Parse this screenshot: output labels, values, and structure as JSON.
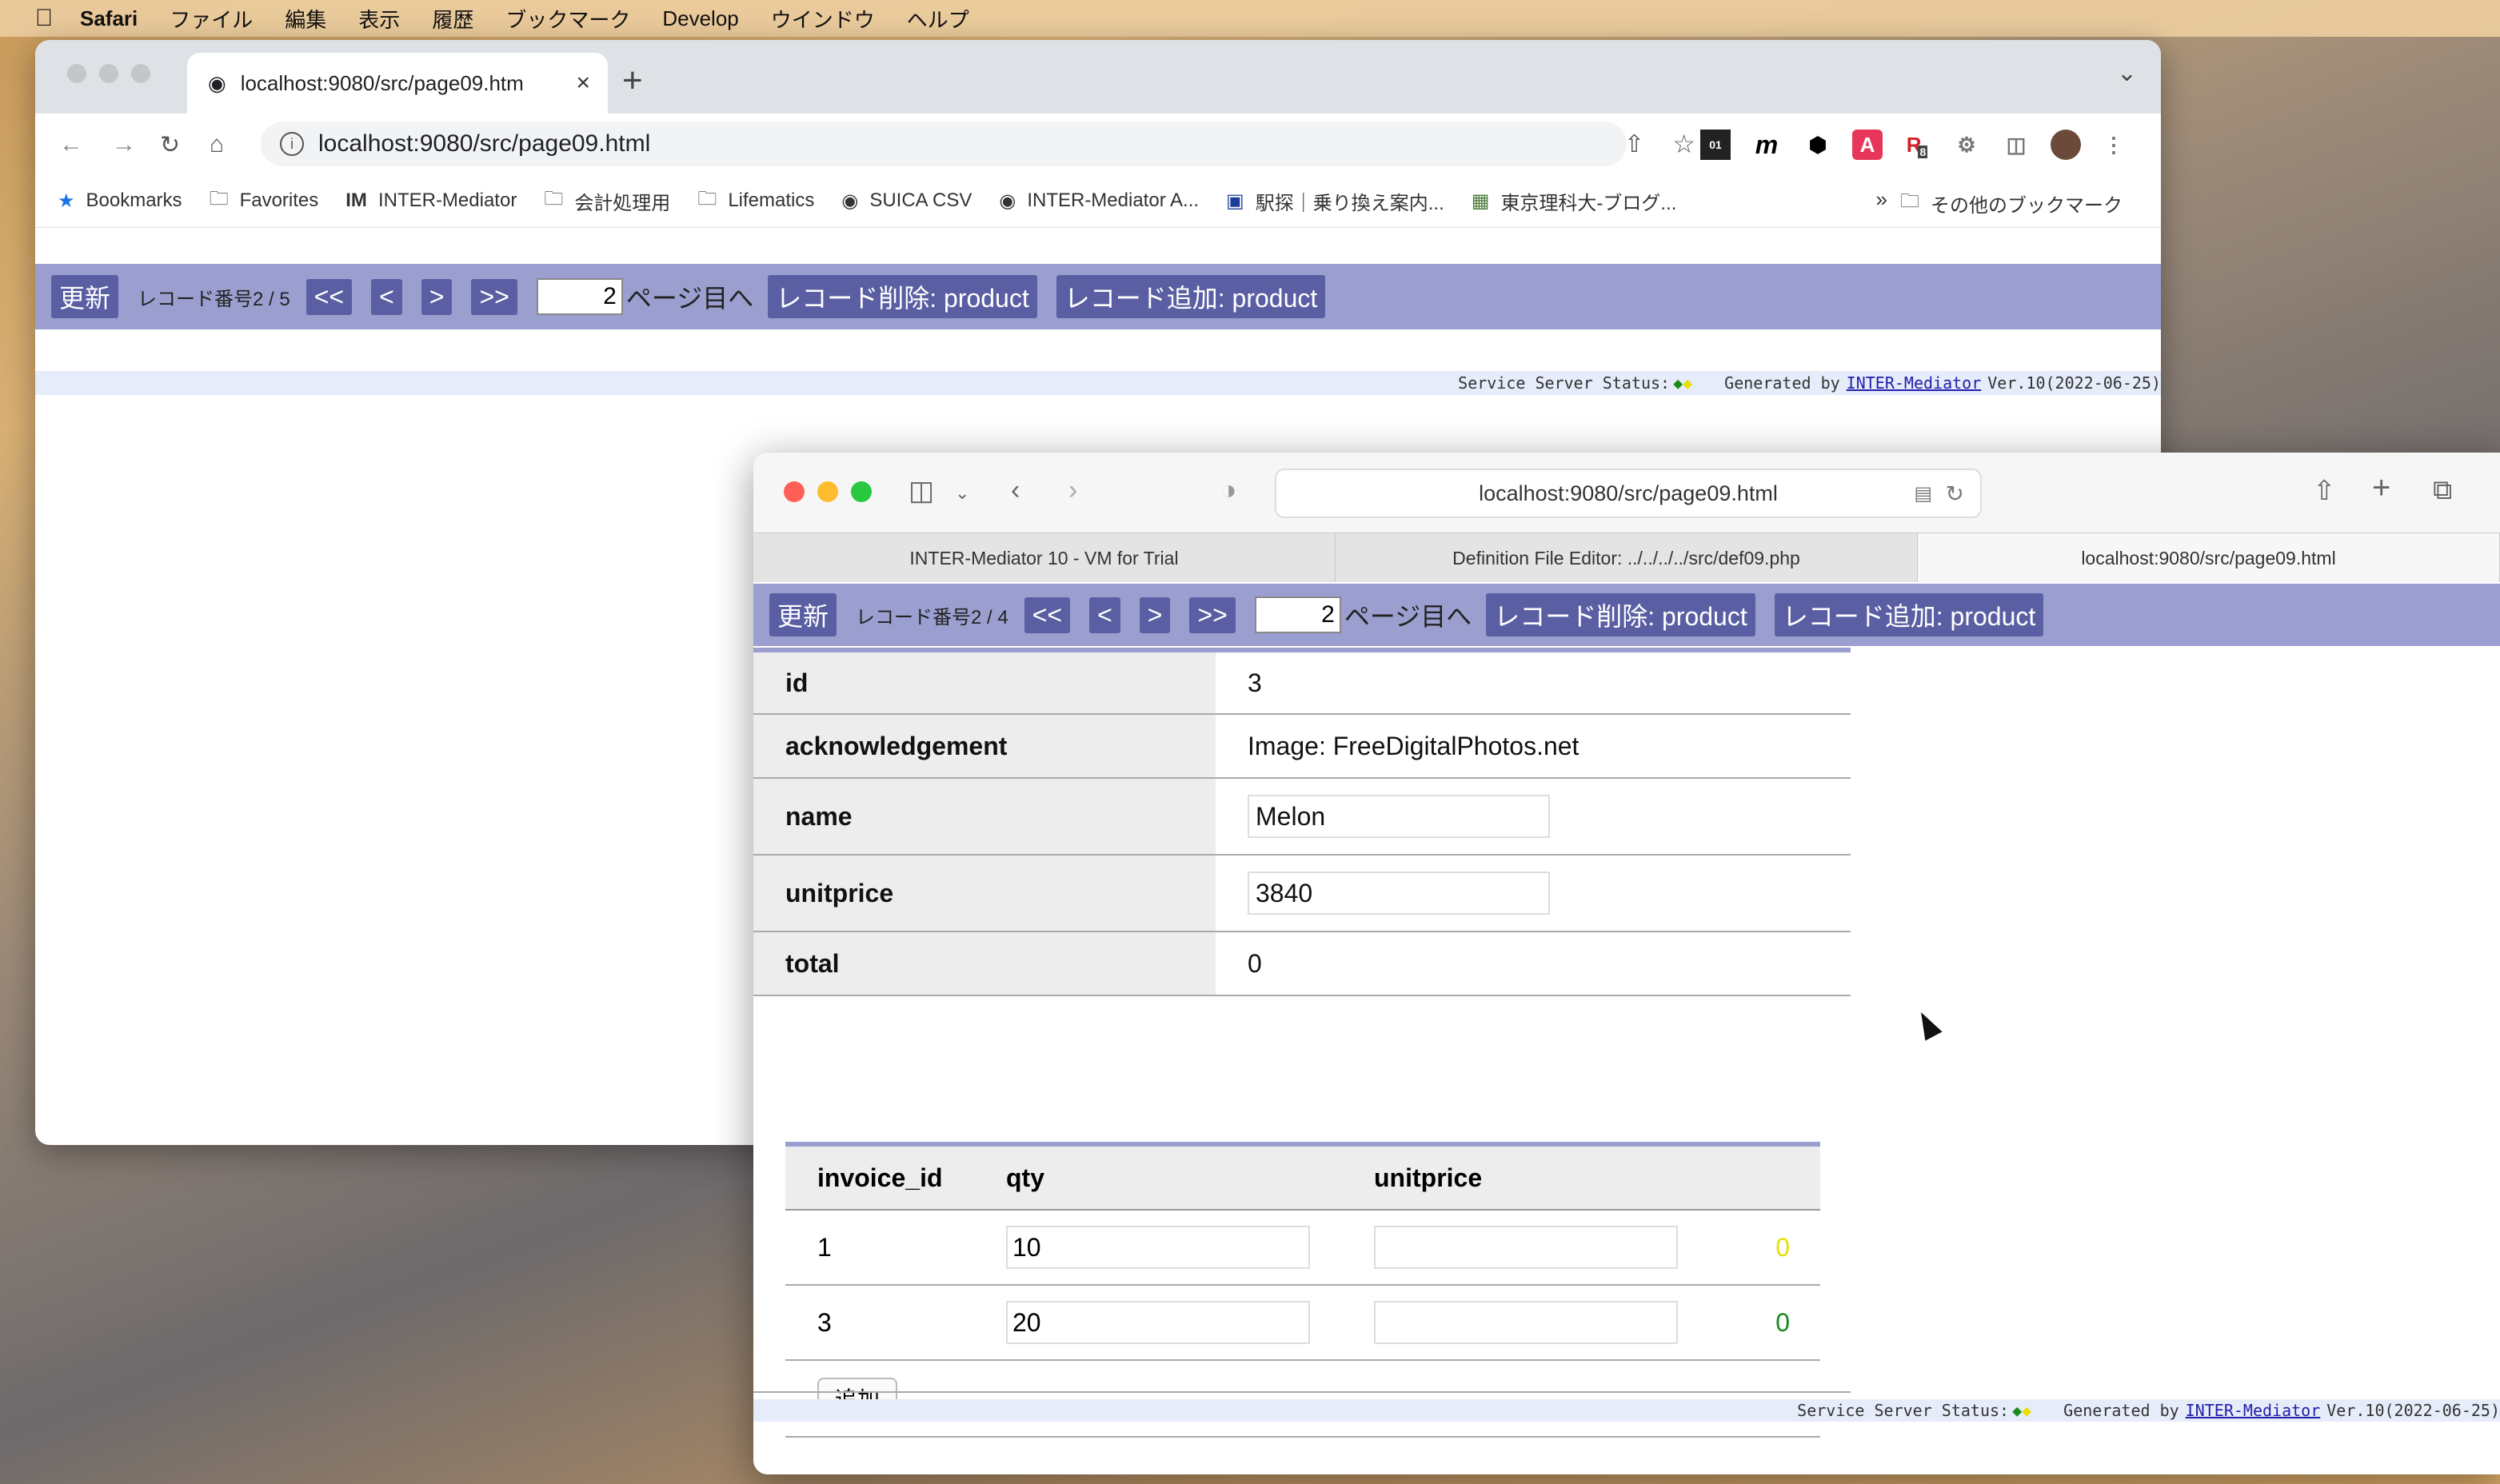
{
  "menubar": {
    "app": "Safari",
    "items": [
      "ファイル",
      "編集",
      "表示",
      "履歴",
      "ブックマーク",
      "Develop",
      "ウインドウ",
      "ヘルプ"
    ]
  },
  "chrome": {
    "tab_title": "localhost:9080/src/page09.htm",
    "url": "localhost:9080/src/page09.html",
    "ext_badge": "8",
    "bookmarks": [
      {
        "icon": "star-icon",
        "label": "Bookmarks"
      },
      {
        "icon": "folder-icon",
        "label": "Favorites"
      },
      {
        "icon": "im-logo-icon",
        "label": "INTER-Mediator"
      },
      {
        "icon": "folder-icon",
        "label": "会計処理用"
      },
      {
        "icon": "folder-icon",
        "label": "Lifematics"
      },
      {
        "icon": "globe-icon",
        "label": "SUICA CSV"
      },
      {
        "icon": "globe-icon",
        "label": "INTER-Mediator A..."
      },
      {
        "icon": "ekitan-icon",
        "label": "駅探｜乗り換え案内..."
      },
      {
        "icon": "tus-icon",
        "label": "東京理科大-ブログ..."
      }
    ],
    "more": "»",
    "other_bookmarks": "その他のブックマーク",
    "nav": {
      "refresh": "更新",
      "record_label": "レコード番号2 / 5",
      "first": "<<",
      "prev": "<",
      "next": ">",
      "last": ">>",
      "page_value": "2",
      "page_label": "ページ目へ",
      "delete": "レコード削除: product",
      "add": "レコード追加: product"
    },
    "footer": {
      "status_label": "Service Server Status:",
      "generated_by": "Generated by",
      "link": "INTER-Mediator",
      "version": "Ver.10(2022-06-25)"
    }
  },
  "safari": {
    "url": "localhost:9080/src/page09.html",
    "tabs": [
      "INTER-Mediator 10 - VM for Trial",
      "Definition File Editor: ../../../../src/def09.php",
      "localhost:9080/src/page09.html"
    ],
    "nav": {
      "refresh": "更新",
      "record_label": "レコード番号2 / 4",
      "first": "<<",
      "prev": "<",
      "next": ">",
      "last": ">>",
      "page_value": "2",
      "page_label": "ページ目へ",
      "delete": "レコード削除: product",
      "add": "レコード追加: product"
    },
    "record": {
      "id_label": "id",
      "id_value": "3",
      "ack_label": "acknowledgement",
      "ack_value": "Image: FreeDigitalPhotos.net",
      "name_label": "name",
      "name_value": "Melon",
      "unitprice_label": "unitprice",
      "unitprice_value": "3840",
      "total_label": "total",
      "total_value": "0"
    },
    "detail": {
      "headers": [
        "invoice_id",
        "qty",
        "unitprice"
      ],
      "rows": [
        {
          "invoice_id": "1",
          "qty": "10",
          "unitprice": "",
          "amount": "0",
          "amount_color": "#e8e000"
        },
        {
          "invoice_id": "3",
          "qty": "20",
          "unitprice": "",
          "amount": "0",
          "amount_color": "#1a8a1a"
        }
      ],
      "add_label": "追加"
    },
    "footer": {
      "status_label": "Service Server Status:",
      "generated_by": "Generated by",
      "link": "INTER-Mediator",
      "version": "Ver.10(2022-06-25)"
    }
  }
}
